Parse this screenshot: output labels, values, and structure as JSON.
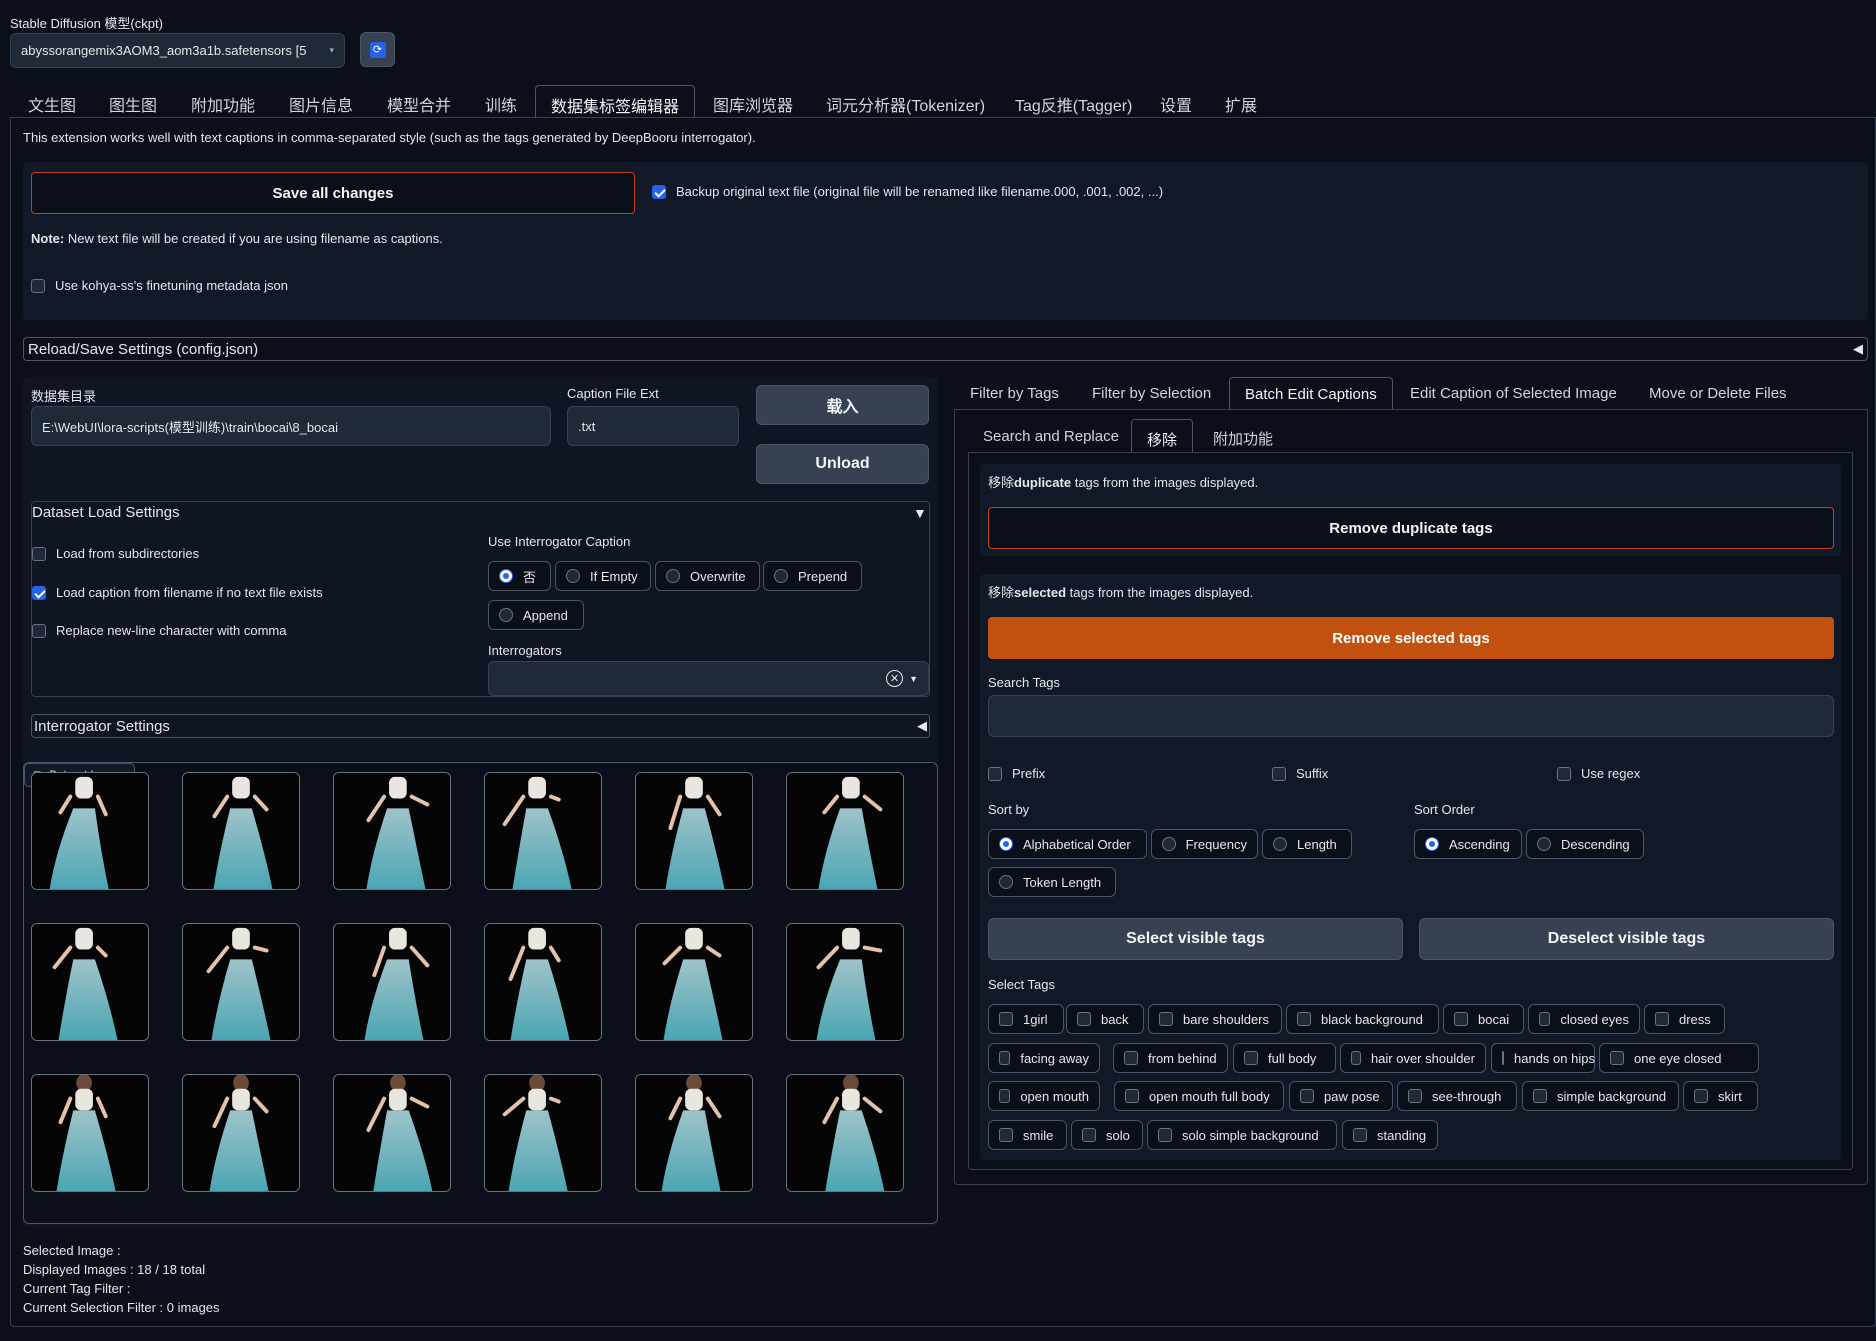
{
  "model": {
    "label": "Stable Diffusion 模型(ckpt)",
    "value": "abyssorangemix3AOM3_aom3a1b.safetensors [5"
  },
  "top_tabs": [
    "文生图",
    "图生图",
    "附加功能",
    "图片信息",
    "模型合并",
    "训练",
    "数据集标签编辑器",
    "图库浏览器",
    "词元分析器(Tokenizer)",
    "Tag反推(Tagger)",
    "设置",
    "扩展"
  ],
  "active_top_tab": 6,
  "intro": "This extension works well with text captions in comma-separated style (such as the tags generated by DeepBooru interrogator).",
  "save_all": "Save all changes",
  "backup_label": "Backup original text file (original file will be renamed like filename.000, .001, .002, ...)",
  "note_bold": "Note:",
  "note_text": " New text file will be created if you are using filename as captions.",
  "kohya_label": "Use kohya-ss's finetuning metadata json",
  "reload_save": "Reload/Save Settings (config.json)",
  "dataset": {
    "dir_label": "数据集目录",
    "dir_value": "E:\\WebUI\\lora-scripts(模型训练)\\train\\bocai\\8_bocai",
    "ext_label": "Caption File Ext",
    "ext_value": ".txt",
    "load_btn": "载入",
    "unload_btn": "Unload"
  },
  "load_settings": {
    "title": "Dataset Load Settings",
    "subdirs": "Load from subdirectories",
    "from_filename": "Load caption from filename if no text file exists",
    "newline": "Replace new-line character with comma",
    "interrogator_caption_label": "Use Interrogator Caption",
    "options": [
      "否",
      "If Empty",
      "Overwrite",
      "Prepend",
      "Append"
    ],
    "interrogators_label": "Interrogators"
  },
  "interrogator_settings": "Interrogator Settings",
  "gallery_label": "Dataset Images",
  "status": {
    "selected": "Selected Image :",
    "displayed": "Displayed Images : 18 / 18 total",
    "tag_filter": "Current Tag Filter :",
    "selection_filter": "Current Selection Filter : 0 images"
  },
  "right_tabs": [
    "Filter by Tags",
    "Filter by Selection",
    "Batch Edit Captions",
    "Edit Caption of Selected Image",
    "Move or Delete Files"
  ],
  "sub_tabs": [
    "Search and Replace",
    "移除",
    "附加功能"
  ],
  "remove_dup": {
    "prefix": "移除",
    "bold": "duplicate",
    "suffix": " tags from the images displayed.",
    "button": "Remove duplicate tags"
  },
  "remove_sel": {
    "prefix": "移除",
    "bold": "selected",
    "suffix": " tags from the images displayed.",
    "button": "Remove selected tags"
  },
  "search_tags_label": "Search Tags",
  "prefix": "Prefix",
  "suffix": "Suffix",
  "use_regex": "Use regex",
  "sort_by": {
    "label": "Sort by",
    "options": [
      "Alphabetical Order",
      "Frequency",
      "Length",
      "Token Length"
    ]
  },
  "sort_order": {
    "label": "Sort Order",
    "options": [
      "Ascending",
      "Descending"
    ]
  },
  "select_visible": "Select visible tags",
  "deselect_visible": "Deselect visible tags",
  "select_tags_label": "Select Tags",
  "tags": [
    "1girl",
    "back",
    "bare shoulders",
    "black background",
    "bocai",
    "closed eyes",
    "dress",
    "facing away",
    "from behind",
    "full body",
    "hair over shoulder",
    "hands on hips",
    "one eye closed",
    "open mouth",
    "open mouth full body",
    "paw pose",
    "see-through",
    "simple background",
    "skirt",
    "smile",
    "solo",
    "solo simple background",
    "standing"
  ],
  "colors": {
    "accent_orange": "#c2510f",
    "accent_blue": "#2563eb",
    "bg": "#0b0f19"
  }
}
